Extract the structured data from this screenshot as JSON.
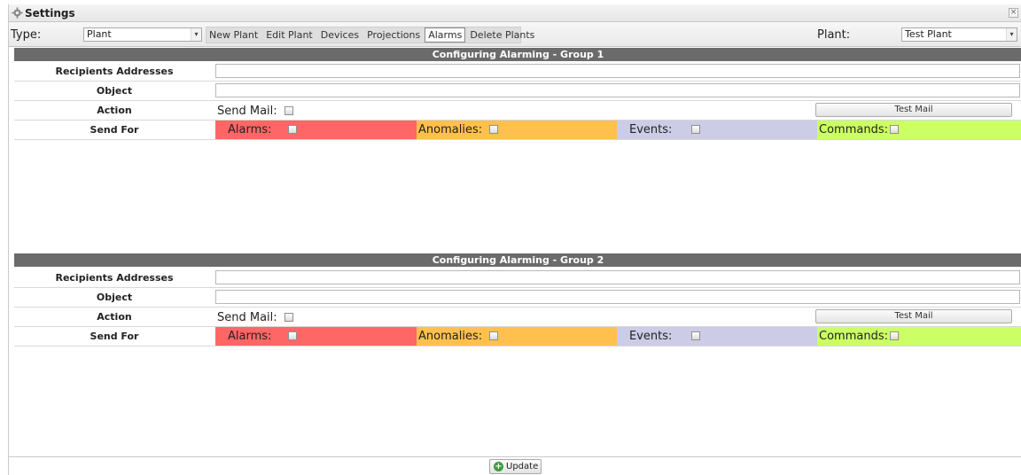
{
  "window": {
    "title": "Settings",
    "close_symbol": "×"
  },
  "toolbar": {
    "type_label": "Type:",
    "type_value": "Plant",
    "tabs": [
      "New Plant",
      "Edit Plant",
      "Devices",
      "Projections",
      "Alarms",
      "Delete Plants"
    ],
    "active_tab": "Alarms",
    "plant_label": "Plant:",
    "plant_value": "Test Plant"
  },
  "groups": [
    {
      "header": "Configuring Alarming - Group 1",
      "recipients_label": "Recipients Addresses",
      "recipients_value": "",
      "object_label": "Object",
      "object_value": "",
      "action_label": "Action",
      "send_mail_label": "Send Mail:",
      "send_mail_checked": false,
      "test_mail_label": "Test Mail",
      "send_for_label": "Send For",
      "send_for": [
        {
          "label": "Alarms:",
          "checked": false,
          "color": "#ff6666"
        },
        {
          "label": "Anomalies:",
          "checked": false,
          "color": "#ffc04d"
        },
        {
          "label": "Events:",
          "checked": false,
          "color": "#cccce6"
        },
        {
          "label": "Commands:",
          "checked": false,
          "color": "#ccff66"
        }
      ]
    },
    {
      "header": "Configuring Alarming - Group 2",
      "recipients_label": "Recipients Addresses",
      "recipients_value": "",
      "object_label": "Object",
      "object_value": "",
      "action_label": "Action",
      "send_mail_label": "Send Mail:",
      "send_mail_checked": false,
      "test_mail_label": "Test Mail",
      "send_for_label": "Send For",
      "send_for": [
        {
          "label": "Alarms:",
          "checked": false,
          "color": "#ff6666"
        },
        {
          "label": "Anomalies:",
          "checked": false,
          "color": "#ffc04d"
        },
        {
          "label": "Events:",
          "checked": false,
          "color": "#cccce6"
        },
        {
          "label": "Commands:",
          "checked": false,
          "color": "#ccff66"
        }
      ]
    }
  ],
  "footer": {
    "update_label": "Update"
  },
  "icons": {
    "title": "gear-icon",
    "close": "close-icon",
    "dropdown": "chevron-down-icon",
    "update": "plus-circle-icon"
  }
}
